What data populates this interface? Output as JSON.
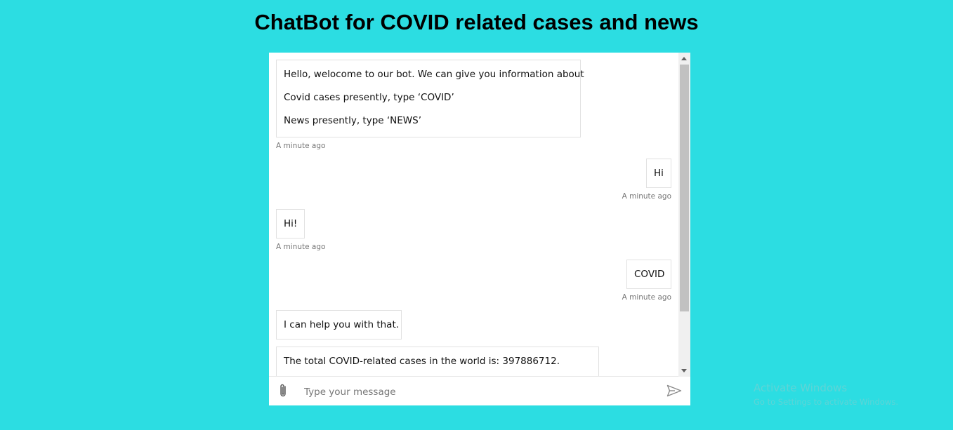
{
  "page": {
    "title": "ChatBot for COVID related cases and news"
  },
  "messages": [
    {
      "from": "bot",
      "lines": [
        "Hello, welocome to our bot. We can give you information about",
        "Covid cases presently, type ‘COVID’",
        "News presently, type ‘NEWS’"
      ],
      "timestamp": "A minute ago"
    },
    {
      "from": "user",
      "lines": [
        "Hi"
      ],
      "timestamp": "A minute ago"
    },
    {
      "from": "bot",
      "lines": [
        "Hi!"
      ],
      "timestamp": "A minute ago"
    },
    {
      "from": "user",
      "lines": [
        "COVID"
      ],
      "timestamp": "A minute ago"
    },
    {
      "from": "bot",
      "lines": [
        "I can help you with that."
      ]
    },
    {
      "from": "bot",
      "lines": [
        "The total COVID-related cases in the world is: 397886712."
      ]
    }
  ],
  "composer": {
    "placeholder": "Type your message",
    "attach_icon": "paperclip-icon",
    "send_icon": "send-icon"
  },
  "watermark": {
    "title": "Activate Windows",
    "subtitle": "Go to Settings to activate Windows."
  },
  "colors": {
    "background": "#2cdde2",
    "chat_background": "#ffffff",
    "bubble_border": "#e1e1e1",
    "timestamp": "#767676"
  }
}
